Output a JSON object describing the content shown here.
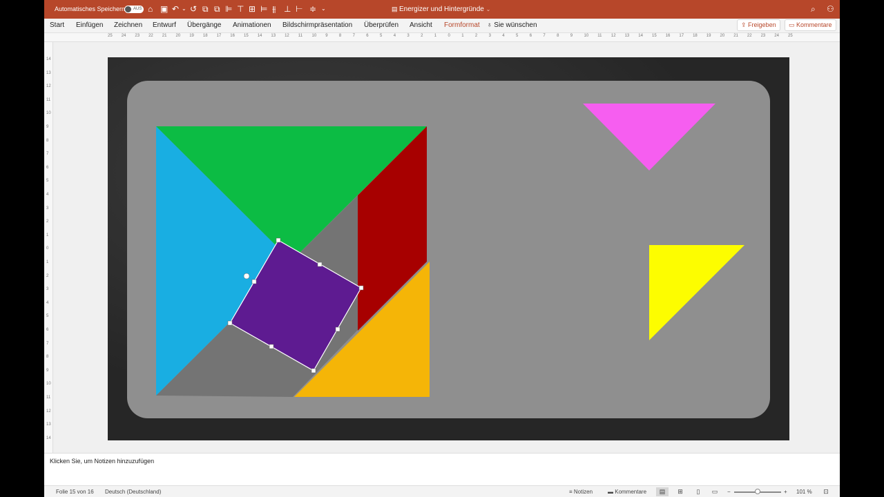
{
  "titlebar": {
    "autosave_label": "Automatisches Speichern",
    "autosave_state": "AUS",
    "doc_title": "Energizer und Hintergründe",
    "doc_caret": "⌄",
    "icons": [
      "home-icon",
      "save-icon",
      "undo-icon",
      "redo-icon",
      "align-icons",
      "search-icon",
      "share-person-icon"
    ]
  },
  "ribbon": {
    "tabs": [
      "Start",
      "Einfügen",
      "Zeichnen",
      "Entwurf",
      "Übergänge",
      "Animationen",
      "Bildschirmpräsentation",
      "Überprüfen",
      "Ansicht",
      "Formformat",
      "Sie wünschen"
    ],
    "active_tab": "Formformat",
    "share_label": "Freigeben",
    "comments_label": "Kommentare"
  },
  "ruler": {
    "h_numbers": [
      "25",
      "24",
      "23",
      "22",
      "21",
      "20",
      "19",
      "18",
      "17",
      "16",
      "15",
      "14",
      "13",
      "12",
      "11",
      "10",
      "9",
      "8",
      "7",
      "6",
      "5",
      "4",
      "3",
      "2",
      "1",
      "0",
      "1",
      "2",
      "3",
      "4",
      "5",
      "6",
      "7",
      "8",
      "9",
      "10",
      "11",
      "12",
      "13",
      "14",
      "15",
      "16",
      "17",
      "18",
      "19",
      "20",
      "21",
      "22",
      "23",
      "24",
      "25"
    ],
    "v_numbers": [
      "14",
      "13",
      "12",
      "11",
      "10",
      "9",
      "8",
      "7",
      "6",
      "5",
      "4",
      "3",
      "2",
      "1",
      "0",
      "1",
      "2",
      "3",
      "4",
      "5",
      "6",
      "7",
      "8",
      "9",
      "10",
      "11",
      "12",
      "13",
      "14"
    ]
  },
  "slide": {
    "background": "#2b2b2b",
    "panel_color": "#8f8f8f",
    "colors": {
      "green": "#0cbc44",
      "blue": "#19aee2",
      "red": "#a70000",
      "orange": "#f5b507",
      "purple": "#5e1b91",
      "gray": "#747474",
      "pink": "#f65ef0",
      "yellow": "#fdfd00"
    }
  },
  "notes": {
    "placeholder": "Klicken Sie, um Notizen hinzuzufügen"
  },
  "statusbar": {
    "slide_info": "Folie 15 von 16",
    "language": "Deutsch (Deutschland)",
    "notes_label": "Notizen",
    "comments_label": "Kommentare",
    "zoom": "101 %",
    "zoom_minus": "−",
    "zoom_plus": "+"
  }
}
